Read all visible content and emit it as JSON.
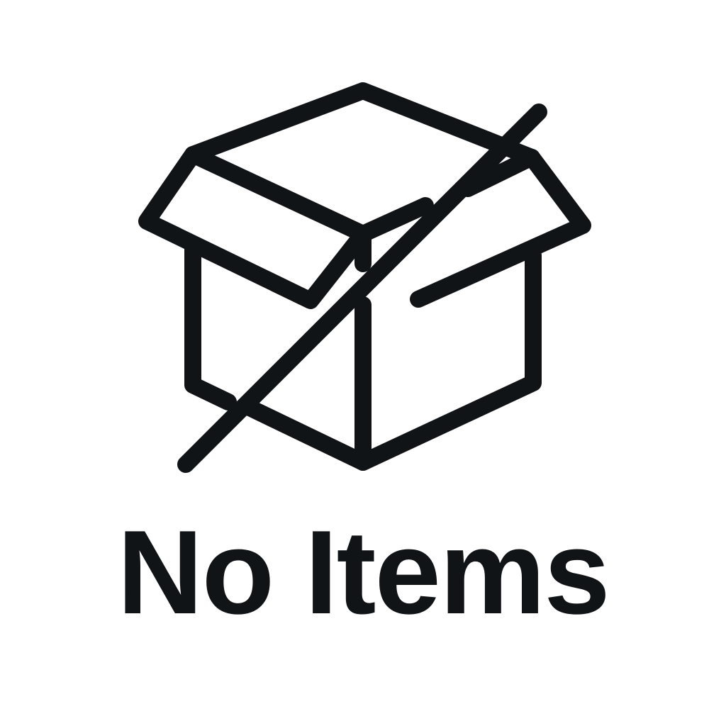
{
  "empty_state": {
    "icon": "empty-box-icon",
    "title": "No Items"
  },
  "colors": {
    "background": "#ffffff",
    "ink": "#111417"
  }
}
